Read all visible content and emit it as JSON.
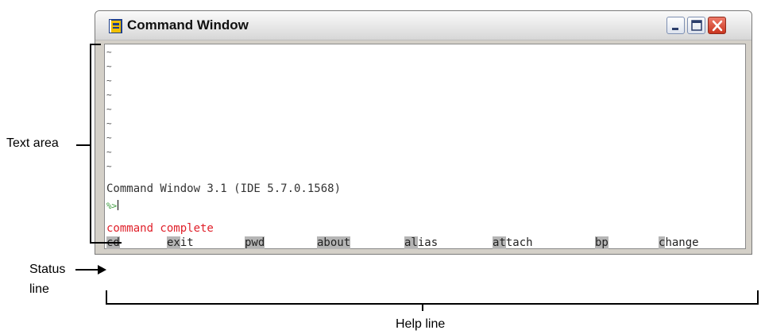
{
  "window": {
    "title": "Command Window",
    "icon": "app-icon",
    "controls": [
      "minimize-icon",
      "maximize-icon",
      "close-icon"
    ]
  },
  "text_area": {
    "tilde_lines": [
      "~",
      "~",
      "~",
      "~",
      "~",
      "~",
      "~",
      "~",
      "~"
    ],
    "banner": "Command Window 3.1 (IDE 5.7.0.1568)",
    "prompt": "%>",
    "status_message": "command complete"
  },
  "help_line": [
    {
      "key": "cd",
      "rest": ""
    },
    {
      "key": "ex",
      "rest": "it"
    },
    {
      "key": "pwd",
      "rest": ""
    },
    {
      "key": "about",
      "rest": ""
    },
    {
      "key": "al",
      "rest": "ias"
    },
    {
      "key": "at",
      "rest": "tach"
    },
    {
      "key": "bp",
      "rest": ""
    },
    {
      "key": "c",
      "rest": "hange"
    }
  ],
  "callouts": {
    "text_area": "Text area",
    "status_line_1": "Status",
    "status_line_2": "line",
    "help_line": "Help line"
  },
  "colors": {
    "status_message": "#e0202a",
    "prompt": "#3a9a3a",
    "help_highlight": "#b5b5b5"
  }
}
